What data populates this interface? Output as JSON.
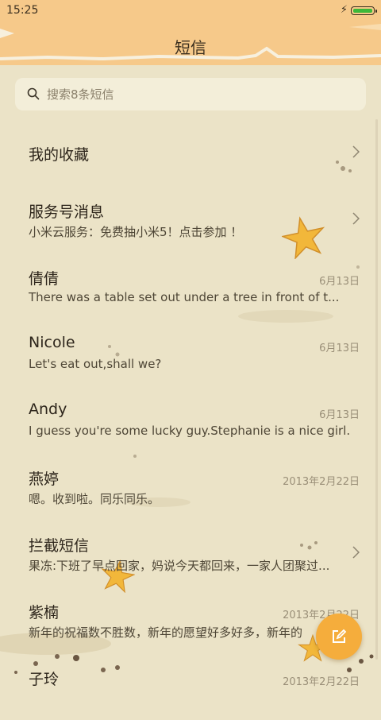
{
  "status_bar": {
    "time": "15:25",
    "battery_level": 1.0
  },
  "header": {
    "title": "短信"
  },
  "search": {
    "placeholder": "搜索8条短信"
  },
  "conversations": [
    {
      "name": "我的收藏",
      "preview": "",
      "date": "",
      "has_chevron": true
    },
    {
      "name": "服务号消息",
      "preview": "小米云服务：免费抽小米5！点击参加 ！",
      "date": "",
      "has_chevron": true
    },
    {
      "name": "倩倩",
      "preview": "There was a table set out under a tree in front of t...",
      "date": "6月13日",
      "has_chevron": false
    },
    {
      "name": "Nicole",
      "preview": "Let's eat out,shall we?",
      "date": "6月13日",
      "has_chevron": false
    },
    {
      "name": "Andy",
      "preview": "I guess you're some lucky guy.Stephanie is a nice girl.",
      "date": "6月13日",
      "has_chevron": false
    },
    {
      "name": "燕婷",
      "preview": "嗯。收到啦。同乐同乐。",
      "date": "2013年2月22日",
      "has_chevron": false
    },
    {
      "name": "拦截短信",
      "preview": "果冻:下班了早点回家，妈说今天都回来，一家人团聚过...",
      "date": "",
      "has_chevron": true
    },
    {
      "name": "紫楠",
      "preview": "新年的祝福数不胜数，新年的愿望好多好多，新年的",
      "date": "2013年2月22日",
      "has_chevron": false
    },
    {
      "name": "子玲",
      "preview": "",
      "date": "2013年2月22日",
      "has_chevron": false
    }
  ],
  "colors": {
    "header": "#f6c98a",
    "background": "#ebe3c7",
    "fab": "#f5ad3c",
    "starfish": "#f2b73a"
  },
  "icons": {
    "search": "search-icon",
    "chevron": "chevron-right-icon",
    "compose": "compose-icon",
    "bolt": "charging-bolt-icon"
  }
}
